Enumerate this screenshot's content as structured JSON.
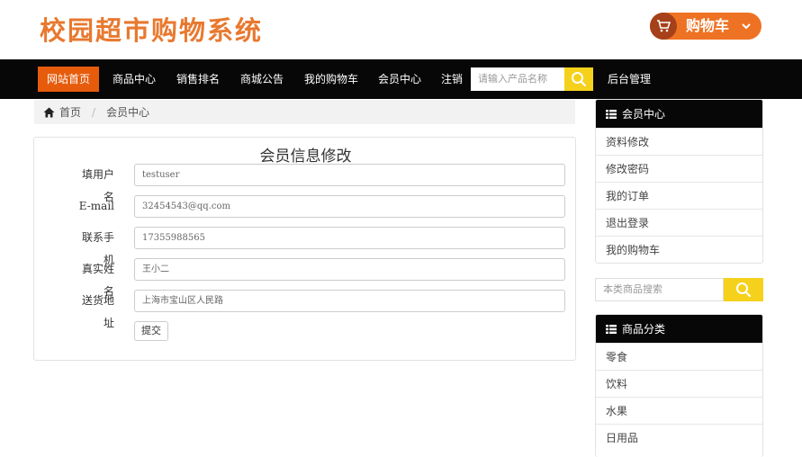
{
  "header": {
    "logo_text": "校园超市购物系统",
    "cart_label": "购物车"
  },
  "nav": {
    "items": [
      "网站首页",
      "商品中心",
      "销售排名",
      "商城公告",
      "我的购物车",
      "会员中心",
      "注销"
    ],
    "search_placeholder": "请输入产品名称",
    "admin": "后台管理"
  },
  "breadcrumb": {
    "home": "首页",
    "current": "会员中心"
  },
  "form": {
    "title": "会员信息修改",
    "fields": [
      {
        "label": "填用户名",
        "value": "testuser"
      },
      {
        "label": "E-mail",
        "value": "32454543@qq.com"
      },
      {
        "label": "联系手机",
        "value": "17355988565"
      },
      {
        "label": "真实姓名",
        "value": "王小二"
      },
      {
        "label": "送货地址",
        "value": "上海市宝山区人民路"
      }
    ],
    "submit": "提交"
  },
  "sidebar": {
    "member_title": "会员中心",
    "member_items": [
      "资料修改",
      "修改密码",
      "我的订单",
      "退出登录",
      "我的购物车"
    ],
    "search_placeholder": "本类商品搜索",
    "category_title": "商品分类",
    "category_items": [
      "零食",
      "饮料",
      "水果",
      "日用品"
    ]
  },
  "colors": {
    "accent_orange": "#e65c0c",
    "logo_orange": "#e8792f",
    "search_yellow": "#f6d11c",
    "nav_black": "#070707"
  }
}
